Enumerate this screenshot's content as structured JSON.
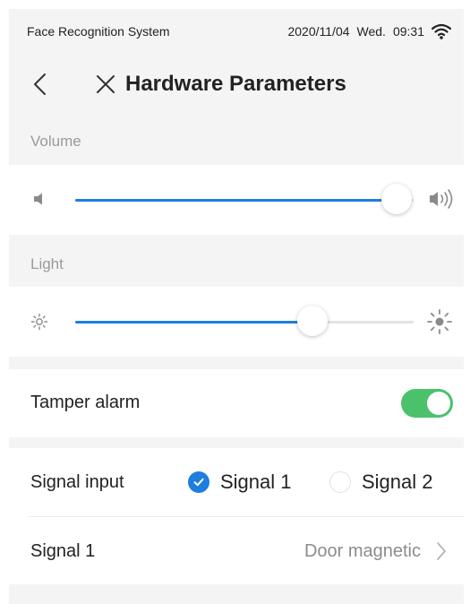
{
  "status_bar": {
    "app_name": "Face Recognition System",
    "date": "2020/11/04",
    "weekday": "Wed.",
    "time": "09:31",
    "icons": [
      "wifi-icon"
    ]
  },
  "header": {
    "title": "Hardware Parameters",
    "icons": [
      "back-icon",
      "close-icon"
    ]
  },
  "volume": {
    "label": "Volume",
    "level_percent": 95,
    "icons": [
      "volume-low-icon",
      "volume-high-icon"
    ]
  },
  "light": {
    "label": "Light",
    "level_percent": 70,
    "icons": [
      "brightness-low-icon",
      "brightness-high-icon"
    ]
  },
  "tamper_alarm": {
    "label": "Tamper alarm",
    "enabled": true
  },
  "signal_input": {
    "label": "Signal input",
    "options": [
      {
        "label": "Signal 1",
        "selected": true
      },
      {
        "label": "Signal 2",
        "selected": false
      }
    ]
  },
  "signal_1": {
    "label": "Signal 1",
    "value": "Door magnetic",
    "icons": [
      "chevron-right-icon"
    ]
  },
  "colors": {
    "accent_blue": "#1e7de0",
    "toggle_green": "#4bc16b",
    "background": "#f4f4f5"
  }
}
